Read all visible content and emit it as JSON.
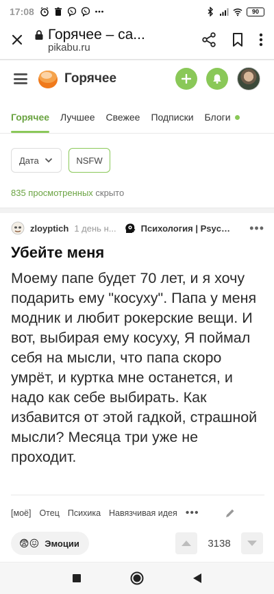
{
  "status_bar": {
    "time": "17:08",
    "battery": "90"
  },
  "browser": {
    "page_title": "Горячее – са...",
    "domain": "pikabu.ru"
  },
  "site_header": {
    "title": "Горячее",
    "accent_color": "#8ac858"
  },
  "tabs": [
    {
      "label": "Горячее",
      "active": true
    },
    {
      "label": "Лучшее",
      "active": false
    },
    {
      "label": "Свежее",
      "active": false
    },
    {
      "label": "Подписки",
      "active": false
    },
    {
      "label": "Блоги",
      "active": false
    }
  ],
  "filters": {
    "date_select": "Дата",
    "nsfw_label": "NSFW"
  },
  "viewed": {
    "count_link": "835 просмотренных",
    "suffix": " скрыто"
  },
  "post": {
    "author": "zloyptich",
    "time": "1 день н...",
    "community": "Психология | Psych...",
    "title": "Убейте меня",
    "body": "Моему папе будет 70 лет, и я хочу подарить ему \"косуху\". Папа у меня модник и любит рокерские вещи. И вот, выбирая ему косуху, Я поймал себя на мысли, что папа скоро умрёт, и куртка мне останется, и надо как себе выбирать. Как избавится от этой гадкой, страшной мысли? Месяца три уже не проходит.",
    "tags": [
      "[моё]",
      "Отец",
      "Психика",
      "Навязчивая идея"
    ],
    "emotions_label": "Эмоции",
    "rating": "3138"
  }
}
